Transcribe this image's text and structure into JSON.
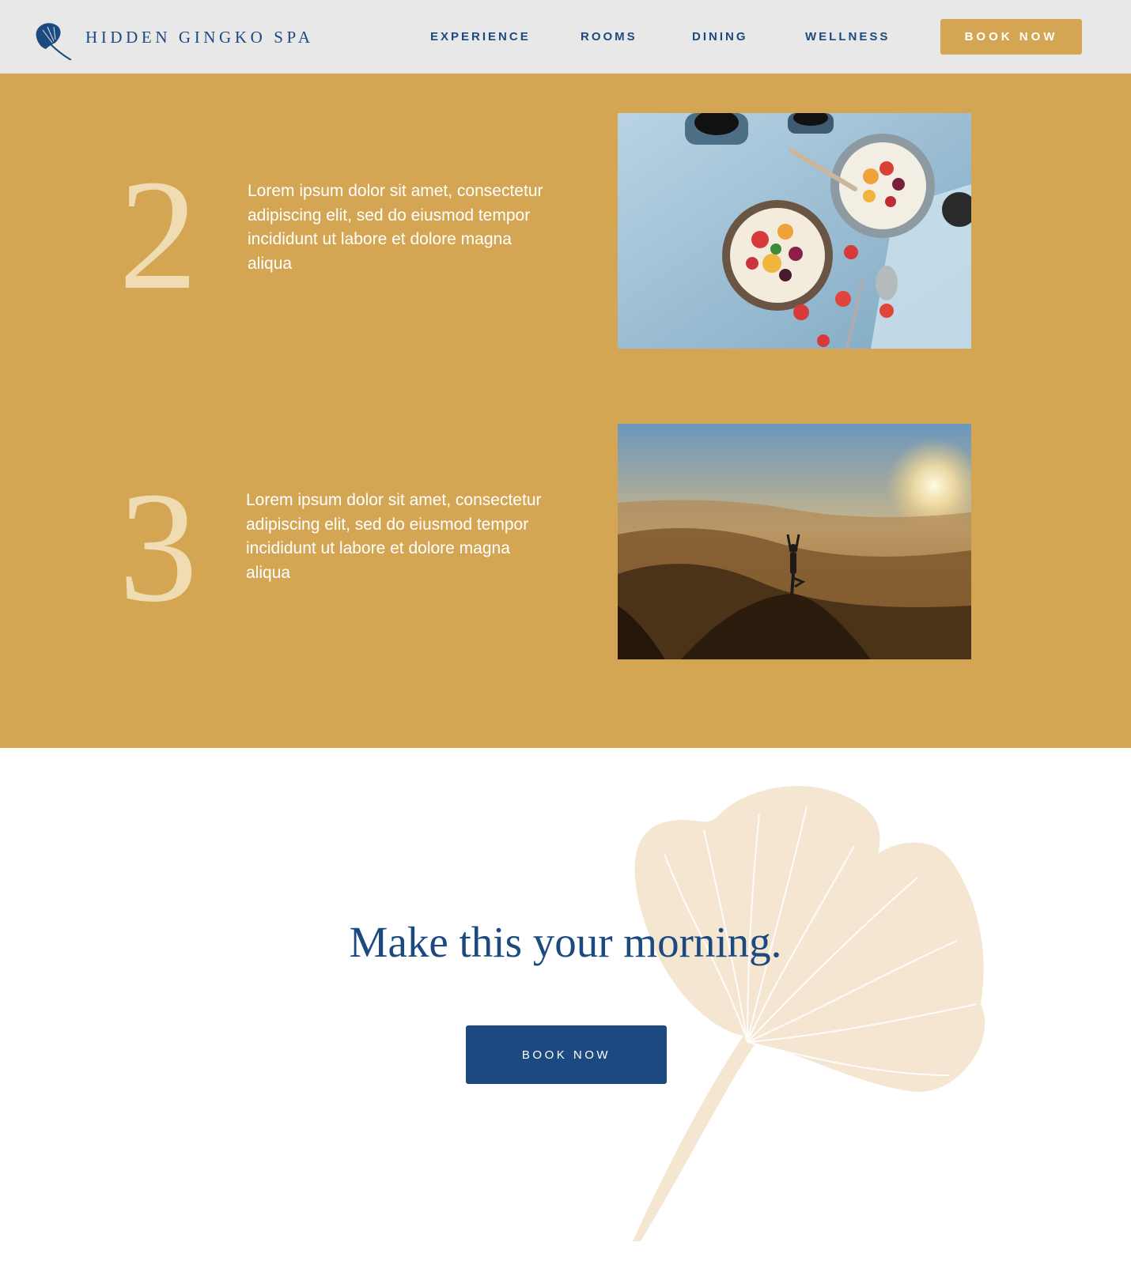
{
  "brand": {
    "name": "HIDDEN GINGKO SPA",
    "icon": "ginkgo-leaf-icon",
    "primary_color": "#1c4a80",
    "accent_color": "#d4a653"
  },
  "nav": {
    "items": [
      {
        "label": "EXPERIENCE"
      },
      {
        "label": "ROOMS"
      },
      {
        "label": "DINING"
      },
      {
        "label": "WELLNESS"
      }
    ],
    "cta_label": "BOOK NOW"
  },
  "steps": [
    {
      "number": "2",
      "text": "Lorem ipsum dolor sit amet, consectetur adipiscing elit, sed do eiusmod tempor incididunt ut labore et dolore magna aliqua",
      "image": "breakfast-bowls-photo"
    },
    {
      "number": "3",
      "text": "Lorem ipsum dolor sit amet, consectetur adipiscing elit, sed do eiusmod tempor incididunt ut labore et dolore magna aliqua",
      "image": "mountain-yoga-sunset-photo"
    }
  ],
  "cta": {
    "title": "Make this your morning.",
    "button_label": "BOOK NOW",
    "decoration": "ginkgo-leaf-illustration"
  }
}
